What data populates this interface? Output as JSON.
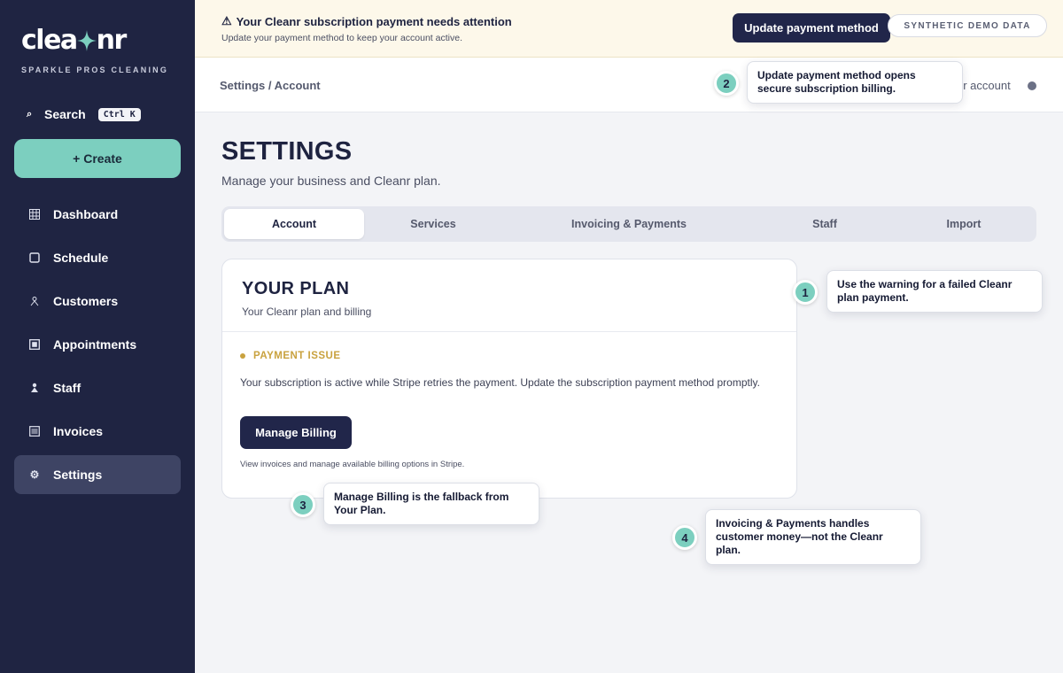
{
  "brand": {
    "name_part1": "clea",
    "name_part2": "nr",
    "subtitle": "SPARKLE PROS CLEANING",
    "accent": "#7ccfbf"
  },
  "sidebar": {
    "search_label": "Search",
    "search_shortcut": "Ctrl K",
    "create_label": "+ Create",
    "items": [
      {
        "label": "Dashboard",
        "icon": "grid-icon"
      },
      {
        "label": "Schedule",
        "icon": "square-icon"
      },
      {
        "label": "Customers",
        "icon": "person-icon"
      },
      {
        "label": "Appointments",
        "icon": "square-icon"
      },
      {
        "label": "Staff",
        "icon": "person-icon"
      },
      {
        "label": "Invoices",
        "icon": "list-icon"
      },
      {
        "label": "Settings",
        "icon": "gear-icon",
        "active": true
      }
    ]
  },
  "banner": {
    "icon": "⚠",
    "title": "Your Cleanr subscription payment needs attention",
    "subtitle": "Update your payment method to keep your account active.",
    "button_label": "Update payment method",
    "badge": "SYNTHETIC DEMO DATA",
    "bg_color": "#fdf8ea"
  },
  "topbar": {
    "breadcrumb": "Settings / Account",
    "account_link": "er account"
  },
  "page": {
    "title": "SETTINGS",
    "subtitle": "Manage your business and Cleanr plan."
  },
  "tabs": [
    {
      "label": "Account",
      "active": true
    },
    {
      "label": "Services"
    },
    {
      "label": "Invoicing & Payments"
    },
    {
      "label": "Staff"
    },
    {
      "label": "Import"
    }
  ],
  "plan": {
    "title": "YOUR PLAN",
    "subtitle": "Your Cleanr plan and billing",
    "status": "PAYMENT ISSUE",
    "status_color": "#c9a23f",
    "message": "Your subscription is active while Stripe retries the payment. Update the subscription payment method promptly.",
    "button_label": "Manage Billing",
    "note": "View invoices and manage available billing options in Stripe."
  },
  "callouts": [
    {
      "number": "1",
      "text": "Use the warning for a failed Cleanr plan payment."
    },
    {
      "number": "2",
      "text": "Update payment method opens secure subscription billing."
    },
    {
      "number": "3",
      "text": "Manage Billing is the fallback from Your Plan."
    },
    {
      "number": "4",
      "text": "Invoicing & Payments handles customer money—not the Cleanr plan."
    }
  ]
}
